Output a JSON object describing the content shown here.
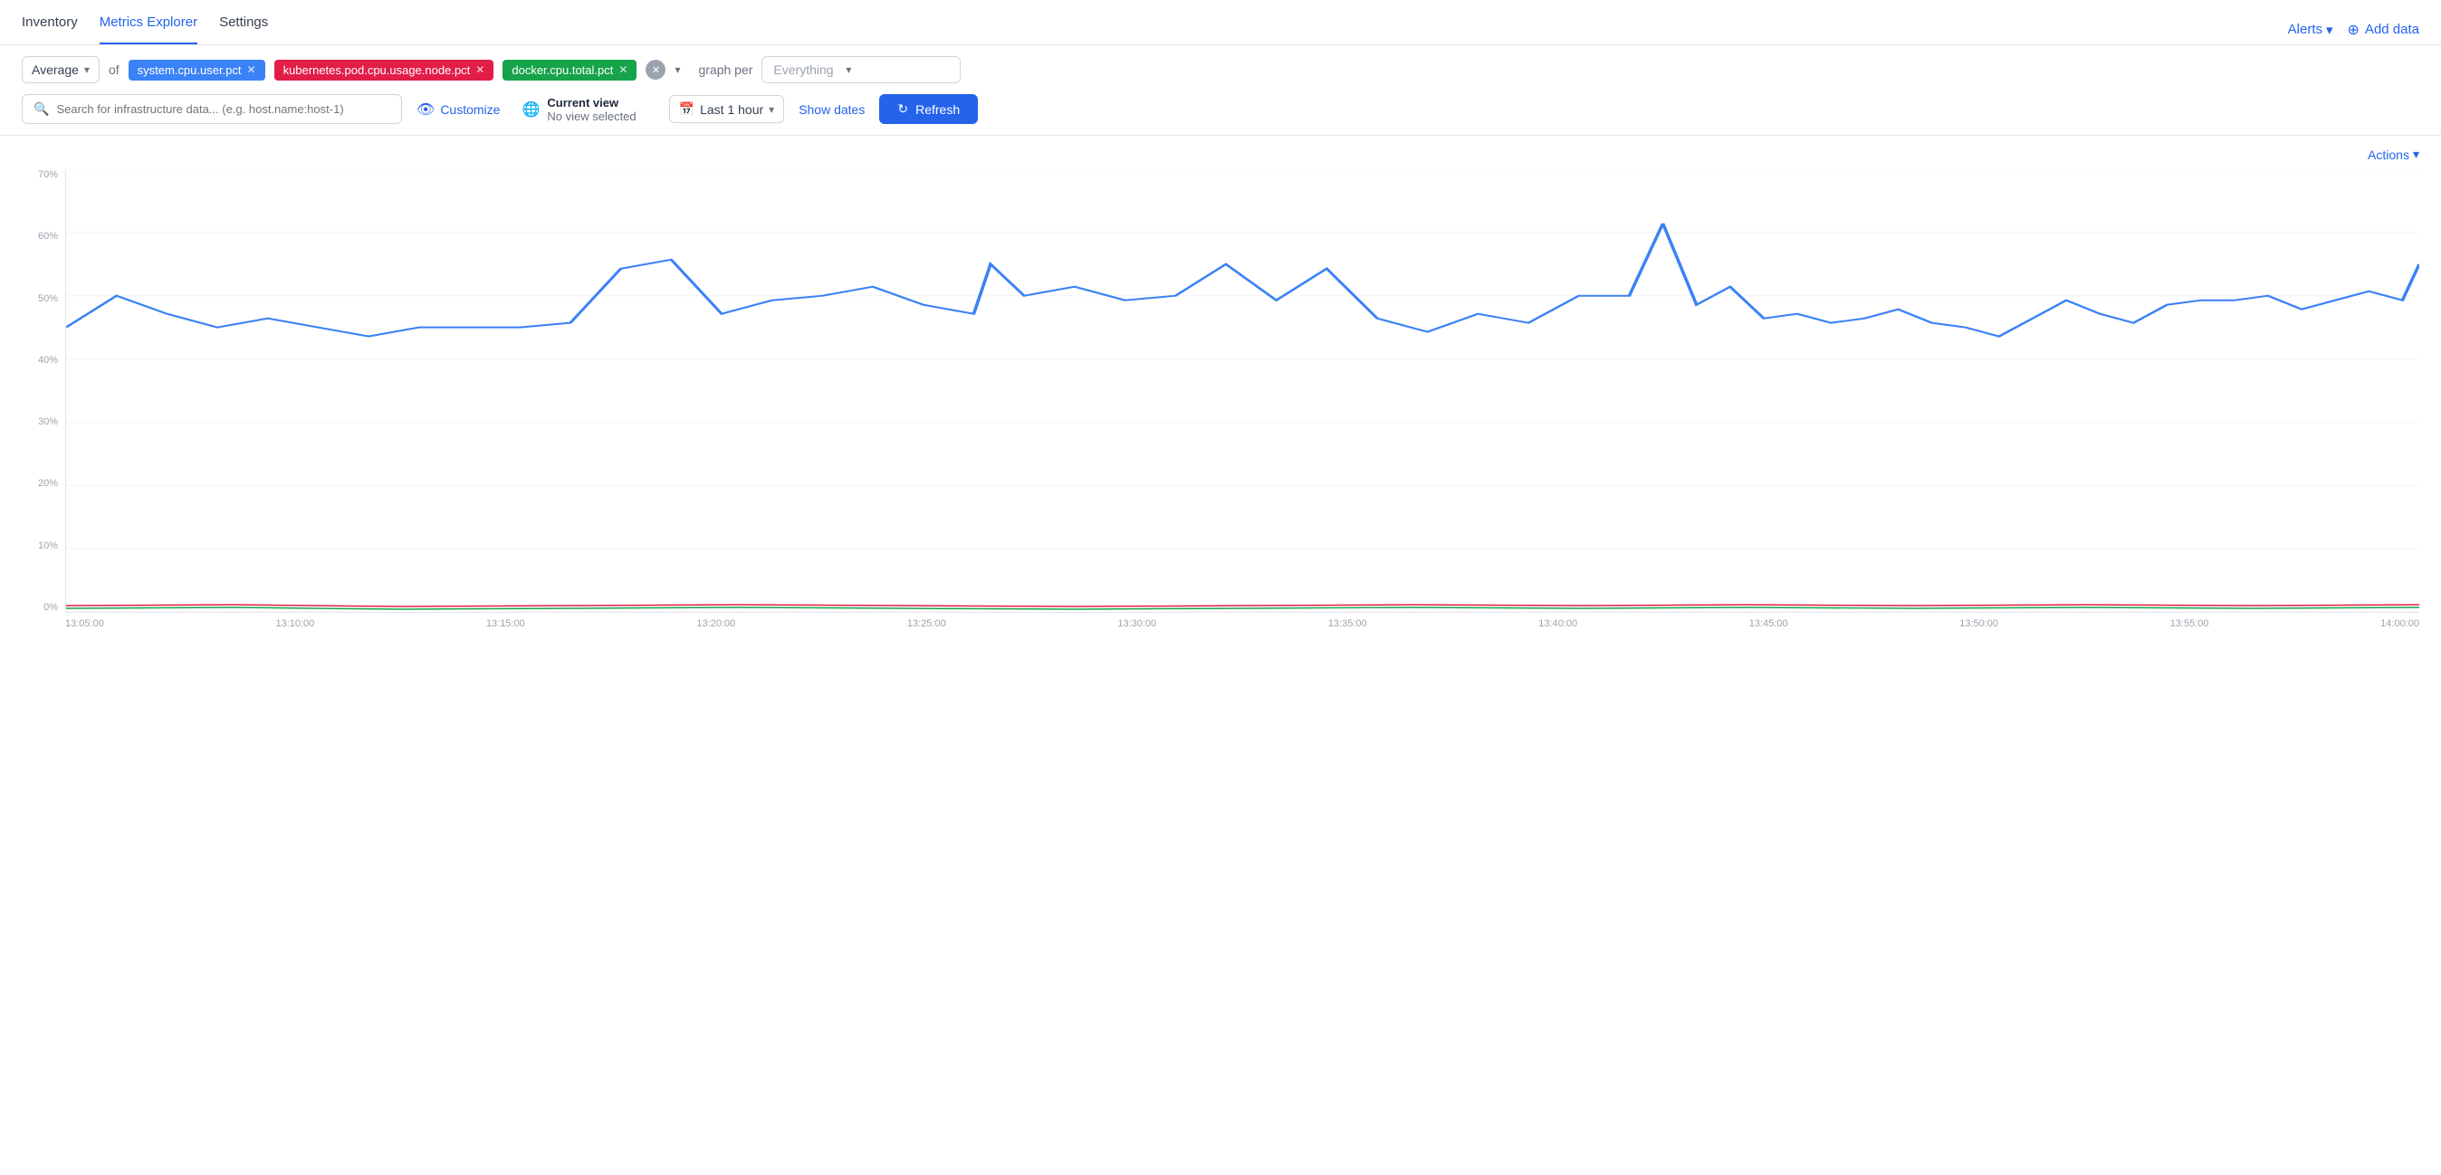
{
  "nav": {
    "tabs": [
      {
        "id": "inventory",
        "label": "Inventory",
        "active": false
      },
      {
        "id": "metrics-explorer",
        "label": "Metrics Explorer",
        "active": true
      },
      {
        "id": "settings",
        "label": "Settings",
        "active": false
      }
    ],
    "alerts_label": "Alerts",
    "add_data_label": "Add data"
  },
  "toolbar": {
    "aggregate": "Average",
    "of_label": "of",
    "metrics": [
      {
        "id": "system-cpu-user-pct",
        "label": "system.cpu.user.pct",
        "color": "blue"
      },
      {
        "id": "kubernetes-pod-cpu",
        "label": "kubernetes.pod.cpu.usage.node.pct",
        "color": "red"
      },
      {
        "id": "docker-cpu-total",
        "label": "docker.cpu.total.pct",
        "color": "green"
      }
    ],
    "graph_per_label": "graph per",
    "graph_per_value": "Everything",
    "search_placeholder": "Search for infrastructure data... (e.g. host.name:host-1)",
    "customize_label": "Customize",
    "current_view_title": "Current view",
    "current_view_sub": "No view selected",
    "time_range": "Last 1 hour",
    "show_dates_label": "Show dates",
    "refresh_label": "Refresh"
  },
  "chart": {
    "actions_label": "Actions",
    "y_labels": [
      "70%",
      "60%",
      "50%",
      "40%",
      "30%",
      "20%",
      "10%",
      "0%"
    ],
    "x_labels": [
      "13:05:00",
      "13:10:00",
      "13:15:00",
      "13:20:00",
      "13:25:00",
      "13:30:00",
      "13:35:00",
      "13:40:00",
      "13:45:00",
      "13:50:00",
      "13:55:00",
      "14:00:00"
    ]
  }
}
